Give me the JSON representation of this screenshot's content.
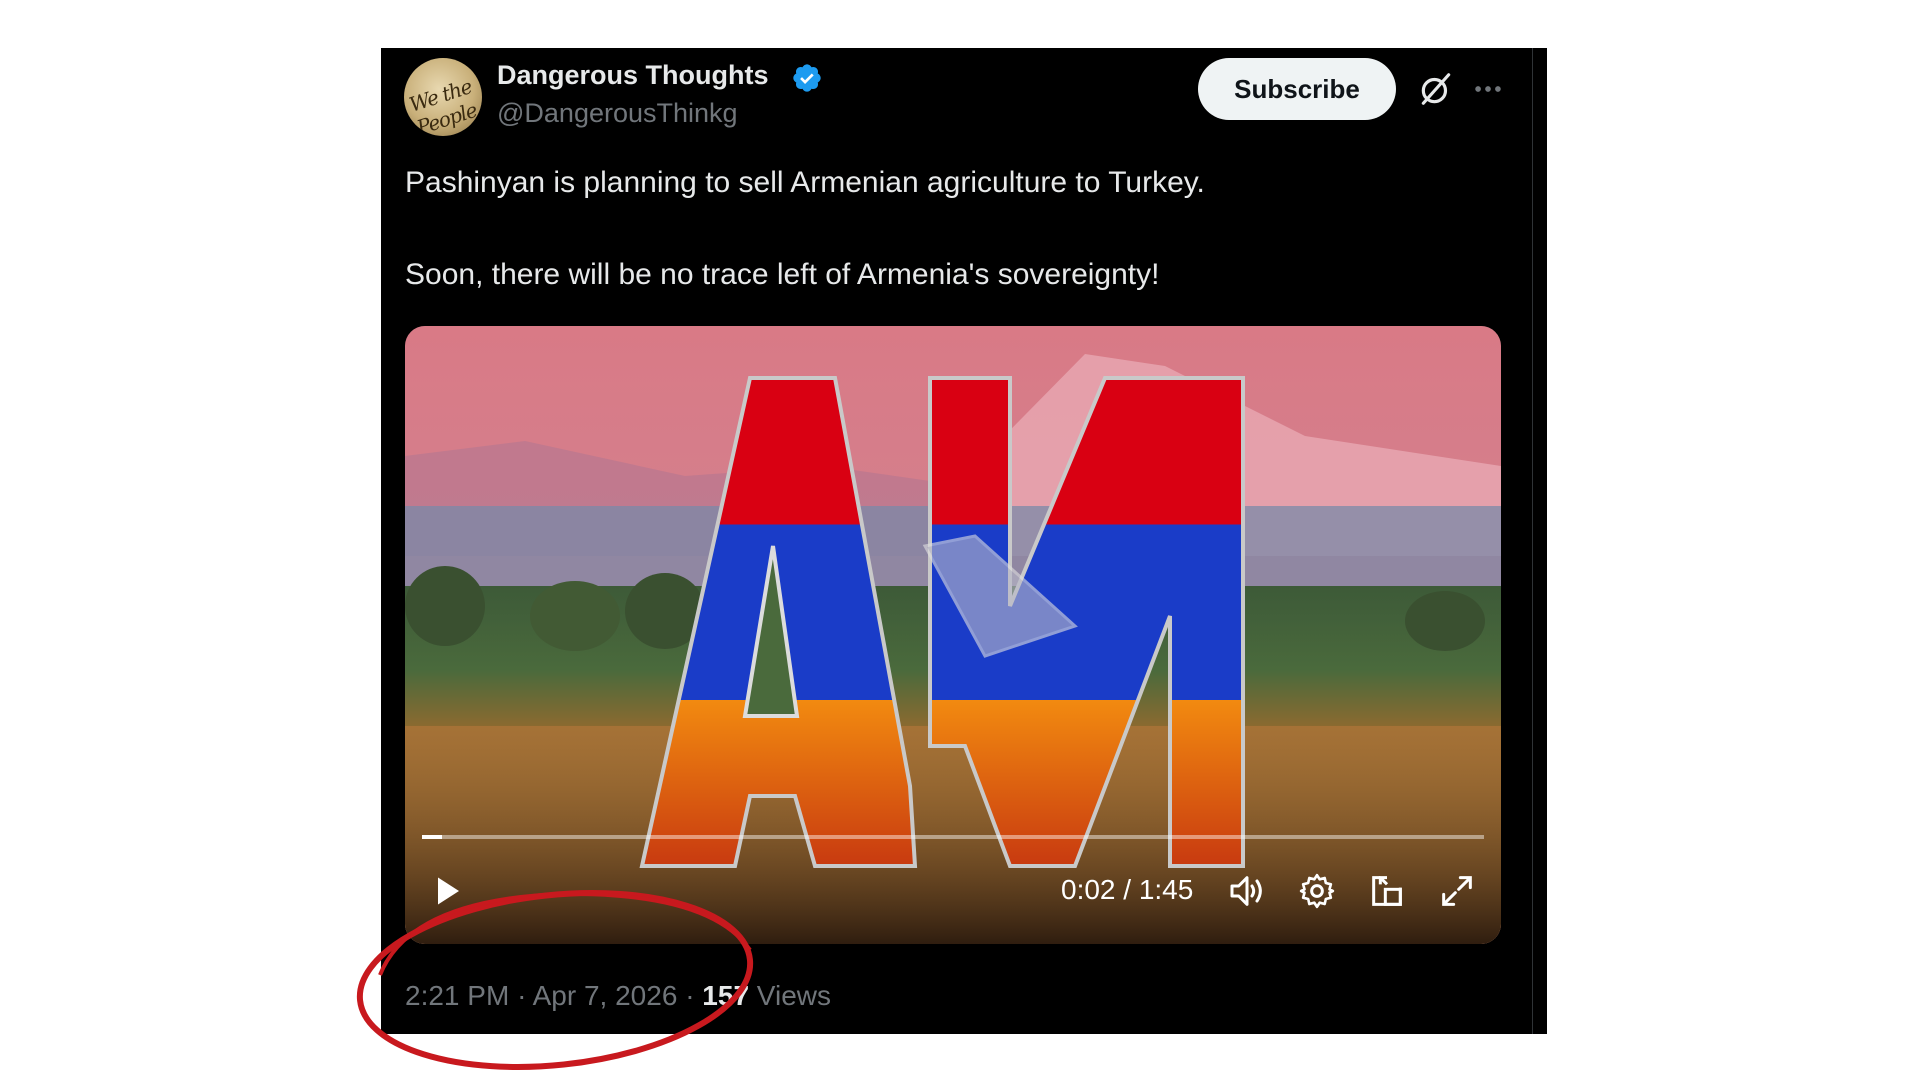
{
  "tweet": {
    "author_name": "Dangerous Thoughts",
    "author_handle": "@DangerousThinkg",
    "avatar_text": "We the People",
    "subscribe_label": "Subscribe",
    "text_line1": "Pashinyan is planning to sell Armenian agriculture to Turkey.",
    "text_line2": "Soon, there will be no trace left of Armenia's sovereignty!",
    "time": "2:21 PM",
    "date": "Apr 7, 2026",
    "separator": "·",
    "views_count": "157",
    "views_label": "Views"
  },
  "video": {
    "current_time": "0:02",
    "duration": "1:45",
    "time_display": "0:02 / 1:45",
    "progress": 0.019,
    "logo_text": "AN"
  },
  "icons": {
    "verified": "verified-badge-icon",
    "grok": "grok-icon",
    "more": "more-icon",
    "play": "play-icon",
    "volume": "volume-icon",
    "settings": "gear-icon",
    "dock": "dock-icon",
    "fullscreen": "fullscreen-icon"
  },
  "colors": {
    "card_background": "#000000",
    "primary_text": "#e7e9ea",
    "secondary_text": "#71767b",
    "verified_blue": "#1d9bf0",
    "annotation_red": "#c8191e",
    "flag_red": "#d90012",
    "flag_blue": "#0033a0",
    "flag_orange": "#f2a800"
  }
}
